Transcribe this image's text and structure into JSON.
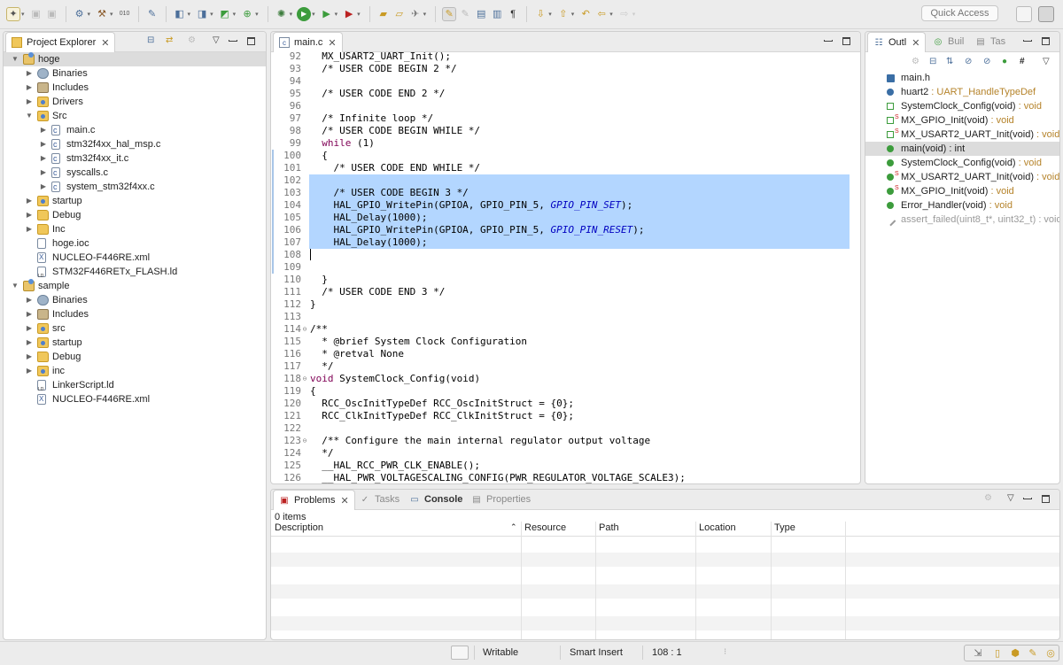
{
  "toolbar": {
    "quick_access_placeholder": "Quick Access"
  },
  "project_explorer": {
    "tab_label": "Project Explorer",
    "tree": [
      {
        "label": "hoge",
        "level": 0,
        "expanded": true,
        "icon": "project-icon",
        "selected": true
      },
      {
        "label": "Binaries",
        "level": 1,
        "expanded": false,
        "icon": "binaries-icon"
      },
      {
        "label": "Includes",
        "level": 1,
        "expanded": false,
        "icon": "includes-icon"
      },
      {
        "label": "Drivers",
        "level": 1,
        "expanded": false,
        "icon": "source-folder-icon"
      },
      {
        "label": "Src",
        "level": 1,
        "expanded": true,
        "icon": "source-folder-icon"
      },
      {
        "label": "main.c",
        "level": 2,
        "expanded": false,
        "icon": "c-file-icon"
      },
      {
        "label": "stm32f4xx_hal_msp.c",
        "level": 2,
        "expanded": false,
        "icon": "c-file-icon"
      },
      {
        "label": "stm32f4xx_it.c",
        "level": 2,
        "expanded": false,
        "icon": "c-file-icon"
      },
      {
        "label": "syscalls.c",
        "level": 2,
        "expanded": false,
        "icon": "c-file-icon"
      },
      {
        "label": "system_stm32f4xx.c",
        "level": 2,
        "expanded": false,
        "icon": "c-file-icon"
      },
      {
        "label": "startup",
        "level": 1,
        "expanded": false,
        "icon": "source-folder-icon"
      },
      {
        "label": "Debug",
        "level": 1,
        "expanded": false,
        "icon": "folder-icon"
      },
      {
        "label": "Inc",
        "level": 1,
        "expanded": false,
        "icon": "folder-icon"
      },
      {
        "label": "hoge.ioc",
        "level": 1,
        "leaf": true,
        "icon": "file-icon"
      },
      {
        "label": "NUCLEO-F446RE.xml",
        "level": 1,
        "leaf": true,
        "icon": "xml-file-icon"
      },
      {
        "label": "STM32F446RETx_FLASH.ld",
        "level": 1,
        "leaf": true,
        "icon": "ld-file-icon"
      },
      {
        "label": "sample",
        "level": 0,
        "expanded": true,
        "icon": "project-icon"
      },
      {
        "label": "Binaries",
        "level": 1,
        "expanded": false,
        "icon": "binaries-icon"
      },
      {
        "label": "Includes",
        "level": 1,
        "expanded": false,
        "icon": "includes-icon"
      },
      {
        "label": "src",
        "level": 1,
        "expanded": false,
        "icon": "source-folder-icon"
      },
      {
        "label": "startup",
        "level": 1,
        "expanded": false,
        "icon": "source-folder-icon"
      },
      {
        "label": "Debug",
        "level": 1,
        "expanded": false,
        "icon": "folder-icon"
      },
      {
        "label": "inc",
        "level": 1,
        "expanded": false,
        "icon": "source-folder-icon"
      },
      {
        "label": "LinkerScript.ld",
        "level": 1,
        "leaf": true,
        "icon": "ld-file-icon"
      },
      {
        "label": "NUCLEO-F446RE.xml",
        "level": 1,
        "leaf": true,
        "icon": "xml-file-icon"
      }
    ]
  },
  "editor": {
    "tab_label": "main.c",
    "lines": [
      {
        "n": "92",
        "t": "  MX_USART2_UART_Init();",
        "cls": ""
      },
      {
        "n": "93",
        "t": "  /* USER CODE BEGIN 2 */",
        "cls": "cm"
      },
      {
        "n": "94",
        "t": "",
        "cls": ""
      },
      {
        "n": "95",
        "t": "  /* USER CODE END 2 */",
        "cls": "cm"
      },
      {
        "n": "96",
        "t": "",
        "cls": ""
      },
      {
        "n": "97",
        "t": "  /* Infinite loop */",
        "cls": "cm"
      },
      {
        "n": "98",
        "t": "  /* USER CODE BEGIN WHILE */",
        "cls": "cm"
      },
      {
        "n": "99",
        "t": "  while (1)",
        "cls": "while"
      },
      {
        "n": "100",
        "t": "  {",
        "cls": ""
      },
      {
        "n": "101",
        "t": "    /* USER CODE END WHILE */",
        "cls": "cm"
      },
      {
        "n": "102",
        "t": "",
        "cls": "",
        "hl": true
      },
      {
        "n": "103",
        "t": "    /* USER CODE BEGIN 3 */",
        "cls": "cm",
        "hl": true
      },
      {
        "n": "104",
        "t": "    HAL_GPIO_WritePin(GPIOA, GPIO_PIN_5, ",
        "it": "GPIO_PIN_SET",
        "tail": ");",
        "hl": true
      },
      {
        "n": "105",
        "t": "    HAL_Delay(1000);",
        "cls": "",
        "hl": true
      },
      {
        "n": "106",
        "t": "    HAL_GPIO_WritePin(GPIOA, GPIO_PIN_5, ",
        "it": "GPIO_PIN_RESET",
        "tail": ");",
        "hl": true
      },
      {
        "n": "107",
        "t": "    HAL_Delay(1000);",
        "cls": "",
        "hl": true
      },
      {
        "n": "108",
        "t": "",
        "cls": "",
        "caret": true
      },
      {
        "n": "109",
        "t": "",
        "cls": ""
      },
      {
        "n": "110",
        "t": "  }",
        "cls": ""
      },
      {
        "n": "111",
        "t": "  /* USER CODE END 3 */",
        "cls": "cm"
      },
      {
        "n": "112",
        "t": "}",
        "cls": ""
      },
      {
        "n": "113",
        "t": "",
        "cls": ""
      },
      {
        "n": "114",
        "t": "/**",
        "cls": "cm",
        "fold": true
      },
      {
        "n": "115",
        "t": "  * @brief System Clock Configuration",
        "cls": "cm"
      },
      {
        "n": "116",
        "t": "  * @retval None",
        "cls": "cm"
      },
      {
        "n": "117",
        "t": "  */",
        "cls": "cm"
      },
      {
        "n": "118",
        "t": "void SystemClock_Config(void)",
        "cls": "void",
        "fold": true
      },
      {
        "n": "119",
        "t": "{",
        "cls": ""
      },
      {
        "n": "120",
        "t": "  RCC_OscInitTypeDef RCC_OscInitStruct = {0};",
        "cls": ""
      },
      {
        "n": "121",
        "t": "  RCC_ClkInitTypeDef RCC_ClkInitStruct = {0};",
        "cls": ""
      },
      {
        "n": "122",
        "t": "",
        "cls": ""
      },
      {
        "n": "123",
        "t": "  /** Configure the main internal regulator output voltage",
        "cls": "cm",
        "fold": true
      },
      {
        "n": "124",
        "t": "  */",
        "cls": "cm"
      },
      {
        "n": "125",
        "t": "  __HAL_RCC_PWR_CLK_ENABLE();",
        "cls": ""
      },
      {
        "n": "126",
        "t": "  __HAL_PWR_VOLTAGESCALING_CONFIG(PWR_REGULATOR_VOLTAGE_SCALE3);",
        "cls": ""
      }
    ]
  },
  "outline": {
    "tabs": [
      "Outl",
      "Buil",
      "Tas"
    ],
    "items": [
      {
        "name": "main.h",
        "type": "",
        "icon": "include-icon",
        "color": "#3a6ea5"
      },
      {
        "name": "huart2",
        "type": " : UART_HandleTypeDef",
        "icon": "variable-icon",
        "color": "#3a6ea5"
      },
      {
        "name": "SystemClock_Config(void)",
        "type": " : void",
        "icon": "function-declaration-icon",
        "color": "#3c9c3c"
      },
      {
        "name": "MX_GPIO_Init(void)",
        "type": " : void",
        "icon": "static-function-declaration-icon",
        "color": "#3c9c3c",
        "static": true
      },
      {
        "name": "MX_USART2_UART_Init(void)",
        "type": " : void",
        "icon": "static-function-declaration-icon",
        "color": "#3c9c3c",
        "static": true
      },
      {
        "name": "main(void) : int",
        "type": "",
        "icon": "function-icon",
        "color": "#3c9c3c",
        "selected": true
      },
      {
        "name": "SystemClock_Config(void)",
        "type": " : void",
        "icon": "function-icon",
        "color": "#3c9c3c"
      },
      {
        "name": "MX_USART2_UART_Init(void)",
        "type": " : void",
        "icon": "static-function-icon",
        "color": "#3c9c3c",
        "static": true
      },
      {
        "name": "MX_GPIO_Init(void)",
        "type": " : void",
        "icon": "static-function-icon",
        "color": "#3c9c3c",
        "static": true
      },
      {
        "name": "Error_Handler(void)",
        "type": " : void",
        "icon": "function-icon",
        "color": "#3c9c3c"
      },
      {
        "name": "assert_failed(uint8_t*, uint32_t)",
        "type": " : void",
        "icon": "inactive-function-icon",
        "color": "#9a9a9a",
        "gray": true
      }
    ]
  },
  "bottom": {
    "tabs": [
      "Problems",
      "Tasks",
      "Console",
      "Properties"
    ],
    "item_count": "0 items",
    "columns": [
      "Description",
      "Resource",
      "Path",
      "Location",
      "Type"
    ]
  },
  "status": {
    "writable": "Writable",
    "insert_mode": "Smart Insert",
    "cursor_pos": "108 : 1"
  },
  "colors": {
    "selection": "#b3d6ff",
    "comment": "#3f7f5f",
    "keyword": "#7f0055",
    "constant": "#0000c0"
  }
}
